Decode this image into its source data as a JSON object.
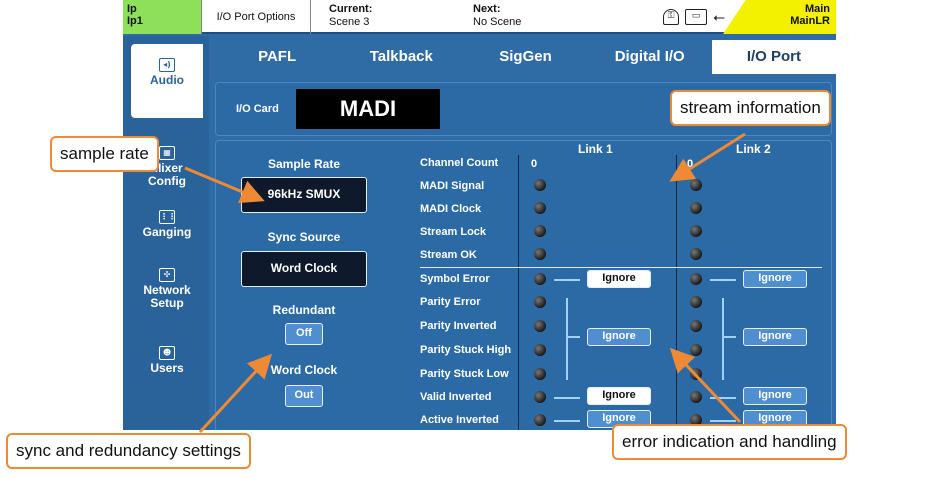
{
  "topbar": {
    "ip_line1": "Ip",
    "ip_line2": "Ip1",
    "screen_name": "I/O Port Options",
    "current_label": "Current:",
    "current_value": "Scene 3",
    "next_label": "Next:",
    "next_value": "No Scene",
    "main_line1": "Main",
    "main_line2": "MainLR",
    "icons": [
      "lock-icon",
      "memory-icon",
      "usb-icon"
    ]
  },
  "sidenav": {
    "items": [
      {
        "label": "Audio",
        "icon": "speaker-icon",
        "active": true
      },
      {
        "label": "Mixer Config",
        "icon": "mixer-config-icon"
      },
      {
        "label": "Ganging",
        "icon": "ganging-icon"
      },
      {
        "label": "Network Setup",
        "icon": "network-icon"
      },
      {
        "label": "Users",
        "icon": "users-icon"
      }
    ]
  },
  "tabs": [
    "PAFL",
    "Talkback",
    "SigGen",
    "Digital I/O",
    "I/O Port"
  ],
  "active_tab": "I/O Port",
  "io_card": {
    "label": "I/O Card",
    "name": "MADI"
  },
  "settings": {
    "sample_rate_title": "Sample Rate",
    "sample_rate_value": "96kHz SMUX",
    "sync_source_title": "Sync Source",
    "sync_source_value": "Word Clock",
    "redundant_title": "Redundant",
    "redundant_value": "Off",
    "word_clock_title": "Word Clock",
    "word_clock_value": "Out"
  },
  "links": {
    "link1_title": "Link 1",
    "link2_title": "Link 2",
    "channel_count_link1": "0",
    "channel_count_link2": "0"
  },
  "stream_rows": [
    "Channel Count",
    "MADI Signal",
    "MADI Clock",
    "Stream Lock",
    "Stream OK"
  ],
  "error_rows": [
    "Symbol Error",
    "Parity Error",
    "Parity Inverted",
    "Parity Stuck High",
    "Parity Stuck Low",
    "Valid Inverted",
    "Active Inverted"
  ],
  "ignore_label": "Ignore",
  "callouts": {
    "stream_information": "stream information",
    "sample_rate": "sample rate",
    "sync_redundancy": "sync and redundancy settings",
    "error_handling": "error indication and handling"
  },
  "colors": {
    "panel_blue": "#2c6aa5",
    "ip_green": "#8ee05a",
    "main_yellow": "#f3f000",
    "callout_orange": "#ee8a35"
  }
}
